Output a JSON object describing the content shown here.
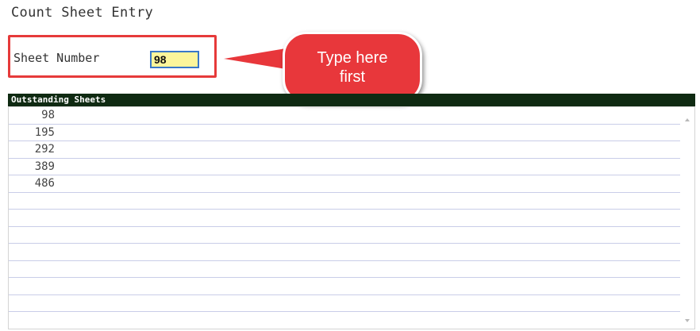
{
  "title": "Count Sheet Entry",
  "sheet_field": {
    "label": "Sheet Number",
    "value": "98"
  },
  "callout": {
    "line1": "Type here",
    "line2": "first"
  },
  "list": {
    "header": "Outstanding Sheets",
    "rows": [
      "98",
      "195",
      "292",
      "389",
      "486",
      "",
      "",
      "",
      "",
      "",
      "",
      "",
      ""
    ]
  },
  "colors": {
    "highlight_border": "#e63a3a",
    "callout_fill": "#e8373b",
    "header_bg": "#0f2a12",
    "input_bg": "#fcf59b",
    "input_border": "#3a78c8"
  },
  "icons": {
    "scroll_up": "scroll-up-arrow",
    "scroll_down": "scroll-down-arrow"
  }
}
